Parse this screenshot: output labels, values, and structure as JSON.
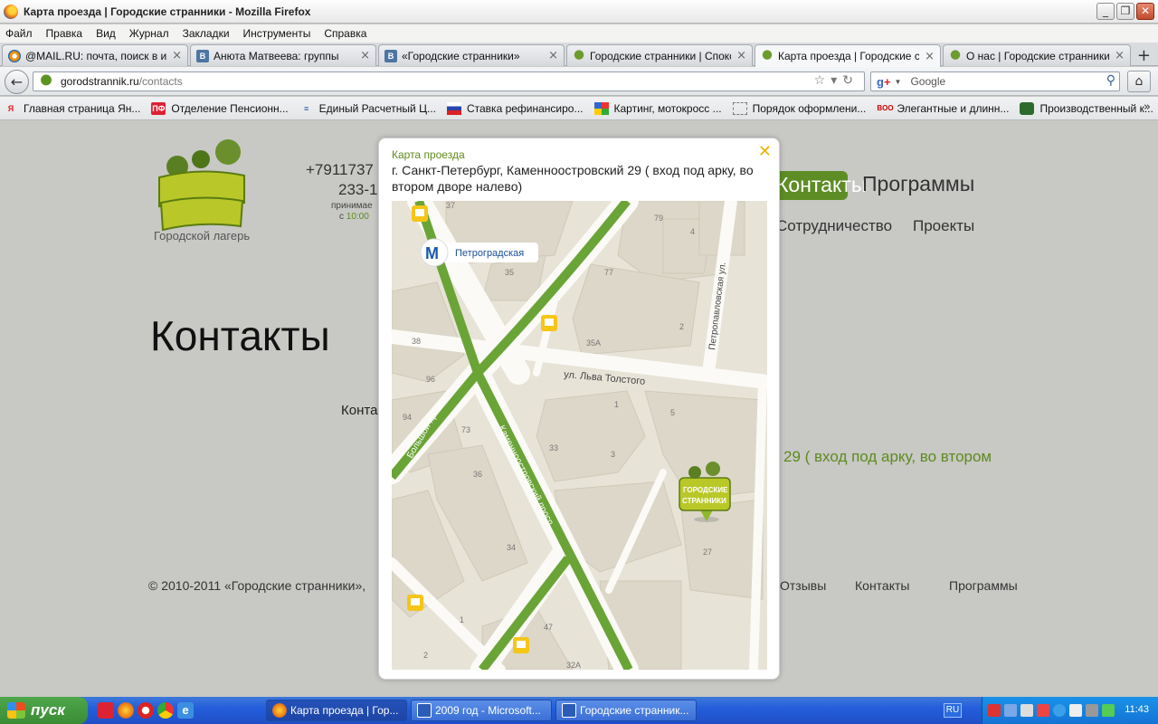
{
  "window": {
    "title": "Карта проезда  | Городские странники - Mozilla Firefox",
    "buttons": [
      "_",
      "❐",
      "✕"
    ]
  },
  "menu": [
    "Файл",
    "Правка",
    "Вид",
    "Журнал",
    "Закладки",
    "Инструменты",
    "Справка"
  ],
  "tabs": [
    {
      "label": "@MAIL.RU: почта, поиск в инт...",
      "icon": "mailru-icon"
    },
    {
      "label": "Анюта Матвеева: группы",
      "icon": "vk-icon"
    },
    {
      "label": "«Городские странники»",
      "icon": "vk-icon"
    },
    {
      "label": "Городские странники | Спокой...",
      "icon": "site-icon"
    },
    {
      "label": "Карта проезда  | Городские стр...",
      "icon": "site-icon",
      "active": true
    },
    {
      "label": "О нас | Городские странники",
      "icon": "site-icon"
    }
  ],
  "nav": {
    "url_domain": "gorodstrannik.ru",
    "url_path": "/contacts",
    "search_placeholder": "Google"
  },
  "bookmarks": [
    "Главная страница Ян...",
    "Отделение Пенсионн...",
    "Единый Расчетный Ц...",
    "Ставка рефинансиро...",
    "Картинг, мотокросс ...",
    "Порядок оформлени...",
    "Элегантные и длинн...",
    "Производственный к..."
  ],
  "page": {
    "logo_text": "Городские странники",
    "logo_sub": "Городской лагерь",
    "phone": "+7911737",
    "phone2": "233-1",
    "phone_note": "принимае",
    "phone_hours_prefix": "с ",
    "phone_hours_time": "10:00",
    "nav_active": "Контакты",
    "nav_programs": "Программы",
    "nav_sub1": "Сотрудничество",
    "nav_sub2": "Проекты",
    "title": "Контакты",
    "contacts_label": "Конта",
    "address_tail": "29 ( вход под арку, во втором",
    "footer_copy": "© 2010-2011 «Городские странники»,",
    "footer_links": [
      "Отзывы",
      "Контакты",
      "Программы"
    ]
  },
  "modal": {
    "header": "Карта проезда",
    "address": "г. Санкт-Петербург, Каменноостровский 29 ( вход под арку, во втором дворе налево)",
    "close": "✕",
    "map": {
      "metro": "Петроградская",
      "streets": [
        "ул. Льва Толстого",
        "Каменноостровский просп.",
        "Большой просп.",
        "Петропавловская ул."
      ],
      "building_numbers": [
        "37",
        "35",
        "79",
        "4",
        "77",
        "35А",
        "2",
        "38",
        "96",
        "1",
        "5",
        "94",
        "73",
        "33",
        "3",
        "36",
        "34",
        "27",
        "1",
        "47",
        "2",
        "32А"
      ],
      "marker_label": "Городские странники"
    }
  },
  "taskbar": {
    "start": "пуск",
    "items": [
      {
        "label": "Карта проезда | Гор...",
        "active": true
      },
      {
        "label": "2009  год - Microsoft..."
      },
      {
        "label": "Городские странник..."
      }
    ],
    "lang": "RU",
    "clock": "11:43"
  }
}
